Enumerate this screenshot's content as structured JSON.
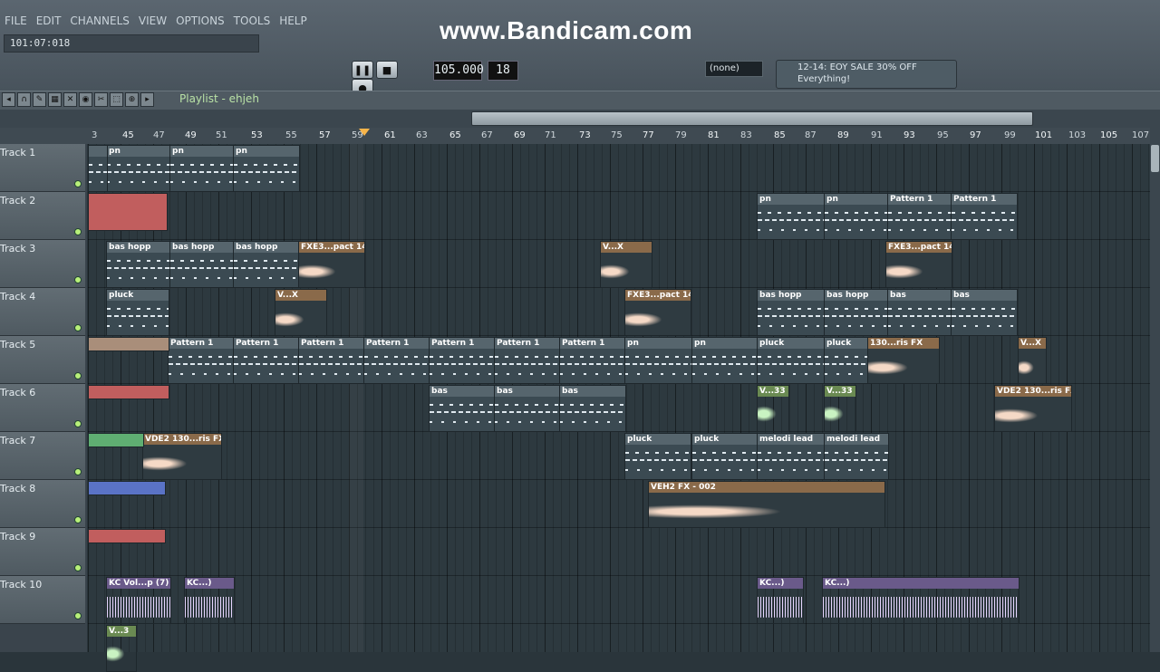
{
  "menu": [
    "FILE",
    "EDIT",
    "CHANNELS",
    "VIEW",
    "OPTIONS",
    "TOOLS",
    "HELP"
  ],
  "hint": "101:07:018",
  "watermark": "www.Bandicam.com",
  "tempo": "105.000",
  "pattern_number": "18",
  "pattern_select": "(none)",
  "news": {
    "line1": "12-14: EOY SALE 30% OFF",
    "line2": "Everything!"
  },
  "playlist": {
    "title": "Playlist - ehjeh"
  },
  "ruler_labels": [
    "3",
    "45",
    "47",
    "49",
    "51",
    "53",
    "55",
    "57",
    "59",
    "61",
    "63",
    "65",
    "67",
    "69",
    "71",
    "73",
    "75",
    "77",
    "79",
    "81",
    "83",
    "85",
    "87",
    "89",
    "91",
    "93",
    "95",
    "97",
    "99",
    "101",
    "103",
    "105",
    "107"
  ],
  "tracks": [
    "Track 1",
    "Track 2",
    "Track 3",
    "Track 4",
    "Track 5",
    "Track 6",
    "Track 7",
    "Track 8",
    "Track 9",
    "Track 10"
  ],
  "clip_names": {
    "pn": "pn",
    "pattern1": "Pattern 1",
    "bas_hopp": "bas hopp",
    "fxe3": "FXE3...pact 14",
    "vx": "V...X",
    "pluck": "pluck",
    "bas": "bas",
    "v33": "V...33",
    "vde2": "VDE2 130...ris FX",
    "melodi": "melodi lead",
    "veh2": "VEH2 FX - 002",
    "kcvol": "KC Vol...p (7)",
    "kc": "KC...)",
    "v3": "V...3",
    "rfx": "130...ris FX"
  }
}
